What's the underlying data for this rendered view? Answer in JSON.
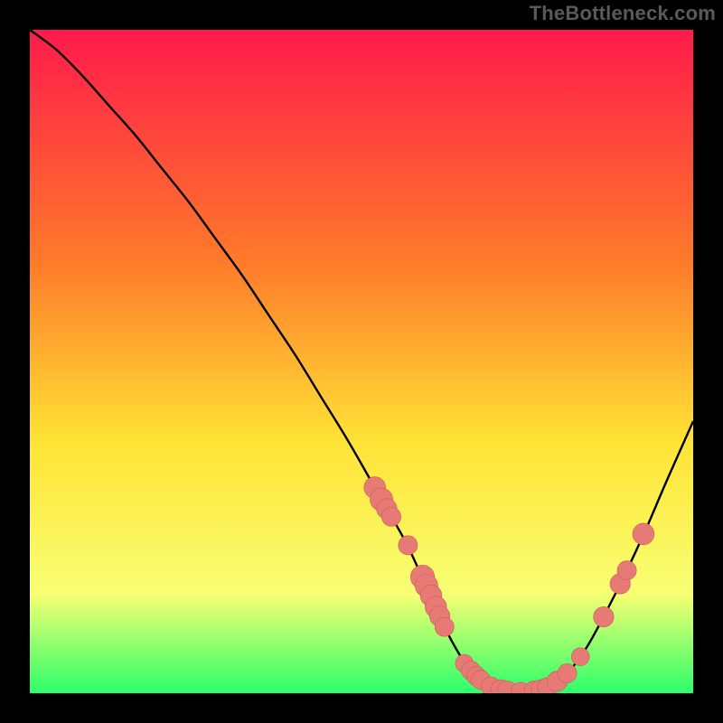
{
  "watermark": "TheBottleneck.com",
  "colors": {
    "background": "#000000",
    "watermark_text": "#5a5a5a",
    "gradient_top": "#ff1a4b",
    "gradient_mid1": "#ff7a2a",
    "gradient_mid2": "#ffe335",
    "gradient_mid3": "#f8ff73",
    "gradient_bottom": "#2cff6a",
    "curve": "#000000",
    "marker_fill": "#e77a74",
    "marker_stroke": "#c95f59"
  },
  "chart_data": {
    "type": "line",
    "title": "",
    "xlabel": "",
    "ylabel": "",
    "xlim": [
      0,
      100
    ],
    "ylim": [
      0,
      100
    ],
    "series": [
      {
        "name": "bottleneck-curve",
        "x": [
          0,
          4,
          8,
          12,
          16,
          20,
          24,
          28,
          32,
          36,
          40,
          44,
          48,
          52,
          56,
          58,
          60,
          63,
          66,
          69,
          72,
          75,
          78,
          81,
          84,
          87,
          90,
          93,
          96,
          100
        ],
        "y": [
          100,
          97,
          93,
          88.5,
          84,
          79,
          74,
          68.5,
          63,
          57,
          51,
          44.5,
          38,
          31,
          24,
          20,
          15.5,
          9,
          4,
          1.2,
          0.3,
          0.2,
          0.8,
          3,
          7,
          12.5,
          18.5,
          25,
          32,
          41
        ]
      }
    ],
    "markers": [
      {
        "x": 52.0,
        "y": 31.0,
        "r": 1.2
      },
      {
        "x": 53.0,
        "y": 29.2,
        "r": 1.3
      },
      {
        "x": 53.8,
        "y": 27.8,
        "r": 1.1
      },
      {
        "x": 54.5,
        "y": 26.6,
        "r": 1.0
      },
      {
        "x": 57.0,
        "y": 22.3,
        "r": 1.0
      },
      {
        "x": 59.2,
        "y": 17.5,
        "r": 1.4
      },
      {
        "x": 59.8,
        "y": 16.2,
        "r": 1.3
      },
      {
        "x": 60.5,
        "y": 14.7,
        "r": 1.2
      },
      {
        "x": 61.2,
        "y": 13.0,
        "r": 1.2
      },
      {
        "x": 61.8,
        "y": 11.6,
        "r": 1.1
      },
      {
        "x": 62.5,
        "y": 10.0,
        "r": 1.0
      },
      {
        "x": 65.5,
        "y": 4.5,
        "r": 0.9
      },
      {
        "x": 66.5,
        "y": 3.4,
        "r": 1.0
      },
      {
        "x": 67.3,
        "y": 2.6,
        "r": 1.0
      },
      {
        "x": 68.0,
        "y": 2.0,
        "r": 1.0
      },
      {
        "x": 69.5,
        "y": 1.0,
        "r": 1.0
      },
      {
        "x": 71.0,
        "y": 0.5,
        "r": 1.1
      },
      {
        "x": 72.0,
        "y": 0.3,
        "r": 1.1
      },
      {
        "x": 74.0,
        "y": 0.2,
        "r": 1.0
      },
      {
        "x": 76.0,
        "y": 0.4,
        "r": 1.0
      },
      {
        "x": 77.0,
        "y": 0.6,
        "r": 1.0
      },
      {
        "x": 78.0,
        "y": 0.9,
        "r": 1.0
      },
      {
        "x": 79.5,
        "y": 1.8,
        "r": 1.1
      },
      {
        "x": 81.0,
        "y": 3.0,
        "r": 1.0
      },
      {
        "x": 83.0,
        "y": 5.5,
        "r": 0.9
      },
      {
        "x": 86.5,
        "y": 11.5,
        "r": 1.1
      },
      {
        "x": 89.0,
        "y": 16.5,
        "r": 1.1
      },
      {
        "x": 90.0,
        "y": 18.5,
        "r": 1.0
      },
      {
        "x": 92.5,
        "y": 24.0,
        "r": 1.2
      }
    ]
  }
}
